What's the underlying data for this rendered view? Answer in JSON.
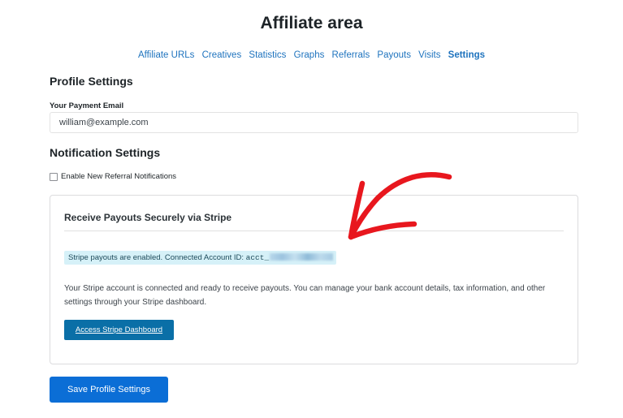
{
  "page": {
    "title": "Affiliate area"
  },
  "tabs": [
    {
      "label": "Affiliate URLs",
      "active": false
    },
    {
      "label": "Creatives",
      "active": false
    },
    {
      "label": "Statistics",
      "active": false
    },
    {
      "label": "Graphs",
      "active": false
    },
    {
      "label": "Referrals",
      "active": false
    },
    {
      "label": "Payouts",
      "active": false
    },
    {
      "label": "Visits",
      "active": false
    },
    {
      "label": "Settings",
      "active": true
    }
  ],
  "profile": {
    "heading": "Profile Settings",
    "email_label": "Your Payment Email",
    "email_value": "william@example.com"
  },
  "notifications": {
    "heading": "Notification Settings",
    "checkbox_label": "Enable New Referral Notifications",
    "checked": false
  },
  "stripe": {
    "title": "Receive Payouts Securely via Stripe",
    "notice_text": "Stripe payouts are enabled. Connected Account ID: ",
    "account_prefix": "acct_",
    "description": "Your Stripe account is connected and ready to receive payouts. You can manage your bank account details, tax information, and other settings through your Stripe dashboard.",
    "button_label": "Access Stripe Dashboard"
  },
  "footer": {
    "save_label": "Save Profile Settings"
  },
  "colors": {
    "link": "#1e73be",
    "primary_button": "#0b6ed6",
    "stripe_button": "#0a6fa7",
    "notice_bg": "#d6f1f8",
    "annotation_arrow": "#e8171e"
  }
}
